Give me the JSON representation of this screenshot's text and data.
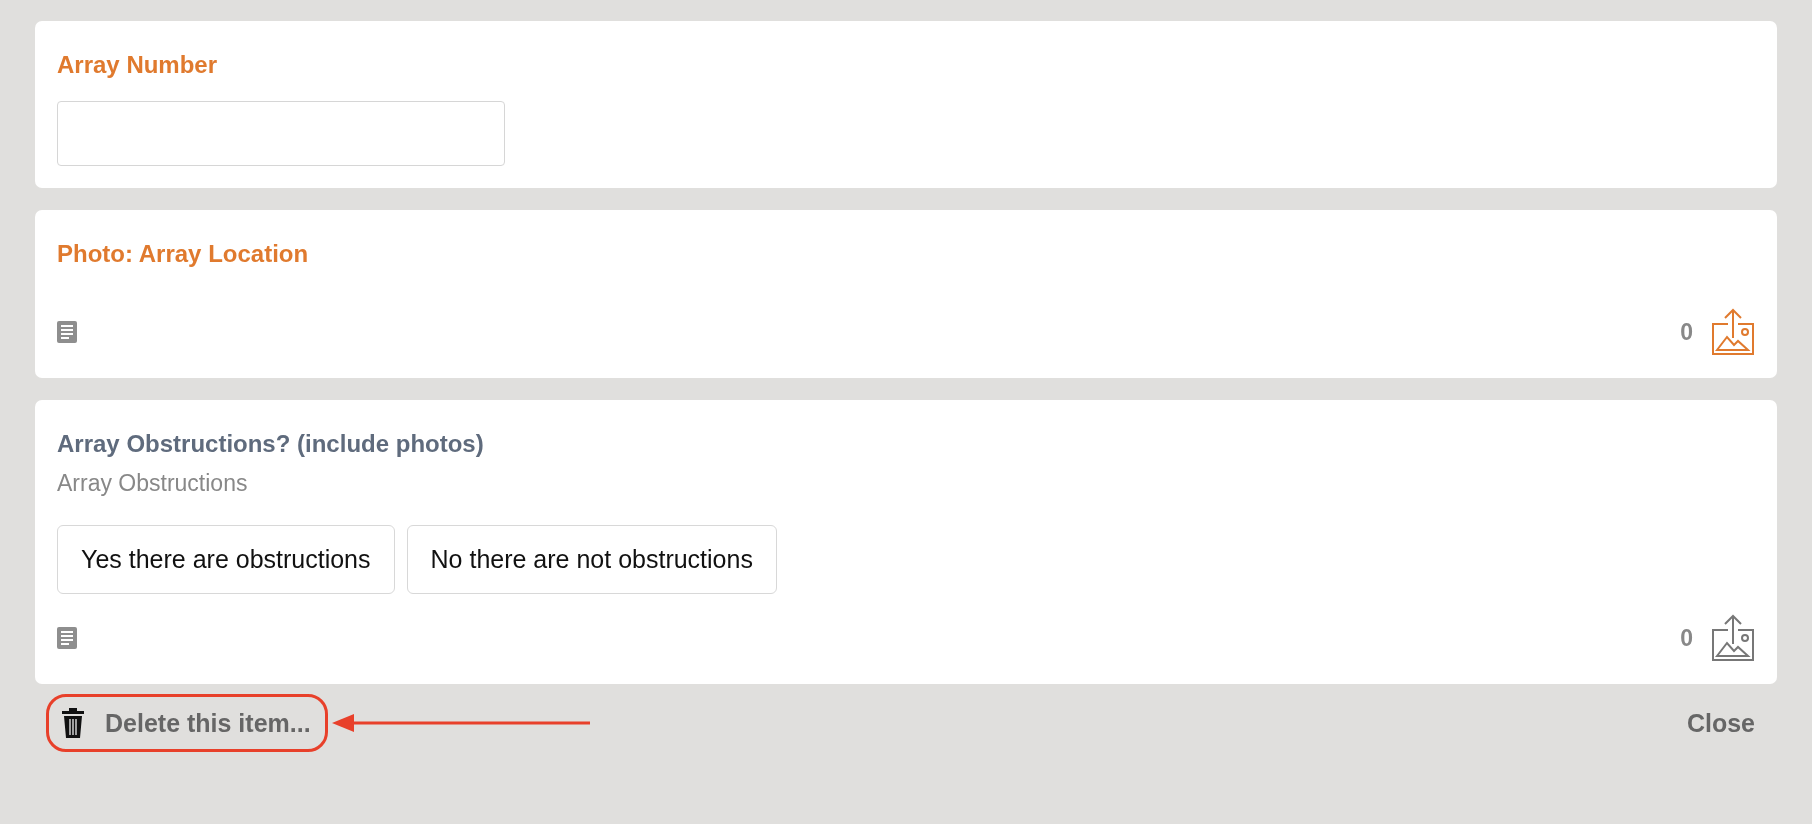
{
  "cards": [
    {
      "kind": "text",
      "title": "Array Number",
      "required": true
    },
    {
      "kind": "photo",
      "title": "Photo: Array Location",
      "required": true,
      "photo_count": "0"
    },
    {
      "kind": "choice",
      "title": "Array Obstructions? (include photos)",
      "subtitle": "Array Obstructions",
      "required": false,
      "options": [
        {
          "label": "Yes there are obstructions",
          "selected": false
        },
        {
          "label": "No there are not obstructions",
          "selected": false
        }
      ],
      "photo_count": "0"
    }
  ],
  "footer": {
    "delete_label": "Delete this item...",
    "highlighted": true,
    "close_label": "Close"
  }
}
